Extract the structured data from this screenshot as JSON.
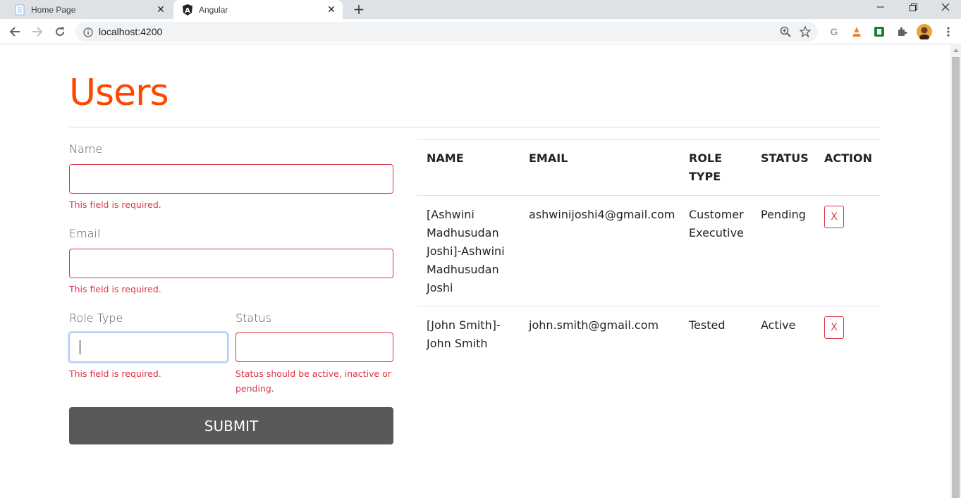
{
  "browser": {
    "tabs": [
      {
        "title": "Home Page",
        "favicon": "document-icon"
      },
      {
        "title": "Angular",
        "favicon": "angular-icon"
      }
    ],
    "url": "localhost:4200"
  },
  "page": {
    "heading": "Users",
    "colors": {
      "heading": "#ff4500",
      "error": "#dc3545",
      "submit_bg": "#595959"
    },
    "form": {
      "name_label": "Name",
      "name_value": "",
      "name_error": "This field is required.",
      "email_label": "Email",
      "email_value": "",
      "email_error": "This field is required.",
      "role_label": "Role Type",
      "role_value": "",
      "role_error": "This field is required.",
      "status_label": "Status",
      "status_value": "",
      "status_error_line1": "Status should be active, inactive or",
      "status_error_line2": "pending.",
      "submit_label": "SUBMIT"
    },
    "table": {
      "headers": {
        "name": "NAME",
        "email": "EMAIL",
        "role_line1": "ROLE",
        "role_line2": "TYPE",
        "status": "STATUS",
        "action": "ACTION"
      },
      "rows": [
        {
          "name_lines": [
            "[Ashwini",
            "Madhusudan",
            "Joshi]-Ashwini",
            "Madhusudan",
            "Joshi"
          ],
          "email": "ashwinijoshi4@gmail.com",
          "role_lines": [
            "Customer",
            "Executive"
          ],
          "status": "Pending",
          "action": "X"
        },
        {
          "name_lines": [
            "[John Smith]-",
            "John Smith"
          ],
          "email": "john.smith@gmail.com",
          "role_lines": [
            "Tested"
          ],
          "status": "Active",
          "action": "X"
        }
      ]
    }
  }
}
